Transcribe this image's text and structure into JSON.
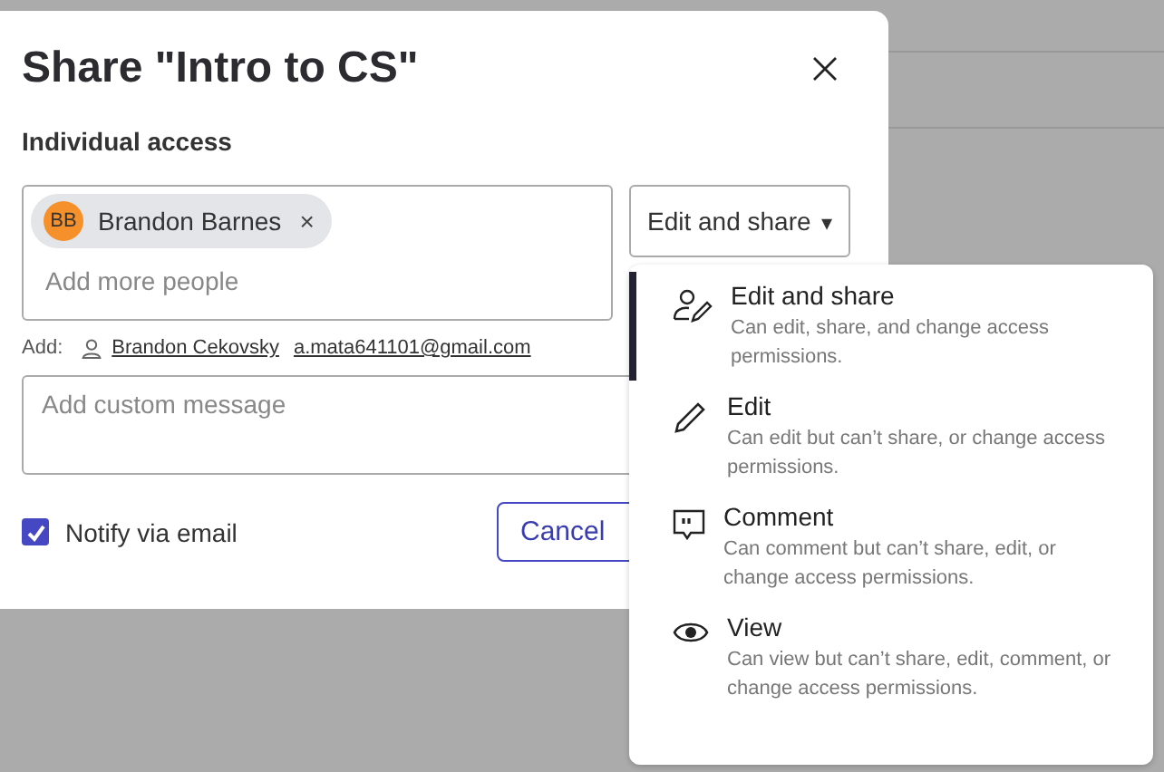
{
  "dialog": {
    "title": "Share \"Intro to CS\"",
    "section_label": "Individual access",
    "people": [
      {
        "initials": "BB",
        "name": "Brandon Barnes",
        "remove": "×",
        "color": "#f5902a"
      }
    ],
    "people_placeholder": "Add more people",
    "access_button": {
      "label": "Edit and share",
      "caret": "▾"
    },
    "add_label": "Add:",
    "suggestions": [
      {
        "kind": "person",
        "text": "Brandon Cekovsky"
      },
      {
        "kind": "email",
        "text": "a.mata641101@gmail.com"
      }
    ],
    "message_placeholder": "Add custom message",
    "notify": {
      "label": "Notify via email",
      "checked": true
    },
    "buttons": [
      "Cancel"
    ]
  },
  "access_menu": [
    {
      "kind": "edit-share",
      "title": "Edit and share",
      "description": "Can edit, share, and change access permissions.",
      "selected": true
    },
    {
      "kind": "edit",
      "title": "Edit",
      "description": "Can edit but can’t share, or change access permissions.",
      "selected": false
    },
    {
      "kind": "comment",
      "title": "Comment",
      "description": "Can comment but can’t share, edit, or change access permissions.",
      "selected": false
    },
    {
      "kind": "view",
      "title": "View",
      "description": "Can view but can’t share, edit, comment, or change access permissions.",
      "selected": false
    }
  ]
}
